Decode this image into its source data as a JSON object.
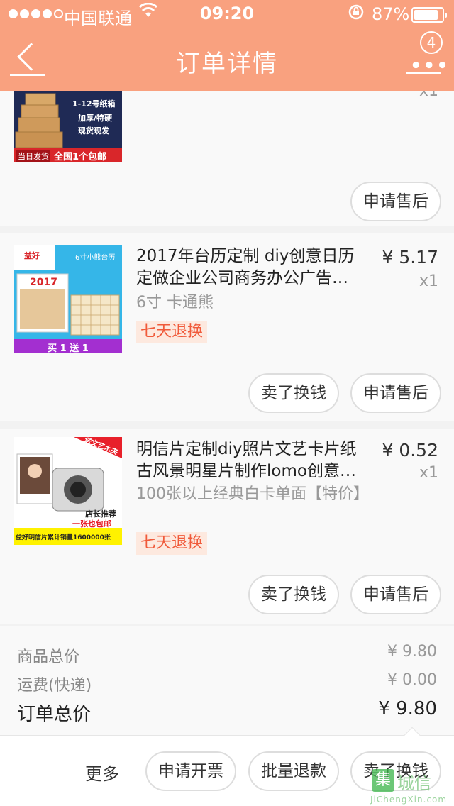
{
  "status_bar": {
    "carrier": "中国联通",
    "time": "09:20",
    "battery_percent": "87%",
    "battery_level": 0.87,
    "wifi_icon": "wifi-icon",
    "rotation_lock_icon": "rotation-lock-icon"
  },
  "nav": {
    "title": "订单详情",
    "back_icon": "back-chevron-icon",
    "more_icon": "more-dots-icon",
    "badge": "4"
  },
  "items": [
    {
      "qty": "x1",
      "thumb": {
        "tags": [
          "当日发货",
          "全国1个包邮"
        ],
        "specs": [
          "1-12号纸箱",
          "加厚/特硬",
          "现货现发"
        ]
      },
      "actions": {
        "after_sale": "申请售后"
      }
    },
    {
      "title": "2017年台历定制 diy创意日历定做企业公司商务办公广告…",
      "price": "¥ 5.17",
      "qty": "x1",
      "spec": "6寸 卡通熊",
      "tag": "七天退换",
      "thumb": {
        "brand": "益好",
        "heading": "6寸小熊台历",
        "year": "2017",
        "banner": "买 1 送 1"
      },
      "actions": {
        "resell": "卖了换钱",
        "after_sale": "申请售后"
      }
    },
    {
      "title": "明信片定制diy照片文艺卡片纸古风景明星片制作lomo创意…",
      "price": "¥ 0.52",
      "qty": "x1",
      "spec": "100张以上经典白卡单面【特价】",
      "tag": "七天退换",
      "thumb": {
        "ribbon": "送文艺木夹",
        "recommend": "店长推荐",
        "free_ship": "一张也包邮",
        "sales": "益好明信片累计销量1600000张"
      },
      "actions": {
        "resell": "卖了换钱",
        "after_sale": "申请售后"
      }
    }
  ],
  "summary": {
    "goods_label": "商品总价",
    "goods_value": "¥ 9.80",
    "shipping_label": "运费(快递)",
    "shipping_value": "¥ 0.00",
    "total_label": "订单总价",
    "total_value": "¥ 9.80"
  },
  "bottom_bar": {
    "more": "更多",
    "invoice": "申请开票",
    "batch_refund": "批量退款",
    "resell": "卖了换钱"
  },
  "watermark": {
    "text": "城信",
    "url": "JiChengXin.com"
  }
}
